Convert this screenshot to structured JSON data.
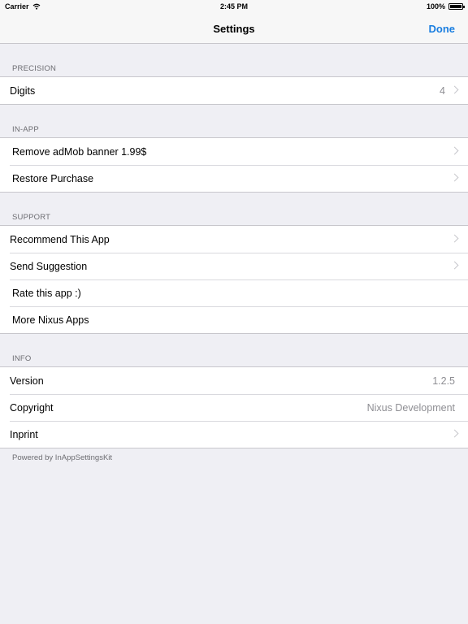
{
  "status_bar": {
    "carrier": "Carrier",
    "time": "2:45 PM",
    "battery": "100%"
  },
  "nav": {
    "title": "Settings",
    "done_label": "Done",
    "accent": "#1a7ee0"
  },
  "sections": {
    "precision": {
      "header": "PRECISION",
      "digits_label": "Digits",
      "digits_value": "4"
    },
    "inapp": {
      "header": "IN-APP",
      "remove_ads_label": "Remove adMob banner 1.99$",
      "restore_label": "Restore Purchase"
    },
    "support": {
      "header": "SUPPORT",
      "recommend_label": "Recommend This App",
      "suggestion_label": "Send Suggestion",
      "rate_label": "Rate this app :)",
      "more_apps_label": "More Nixus Apps"
    },
    "info": {
      "header": "INFO",
      "version_label": "Version",
      "version_value": "1.2.5",
      "copyright_label": "Copyright",
      "copyright_value": "Nixus Development",
      "inprint_label": "Inprint"
    }
  },
  "footer": "Powered by InAppSettingsKit",
  "icons": [
    "wifi-icon",
    "battery-icon",
    "chevron-right-icon"
  ]
}
